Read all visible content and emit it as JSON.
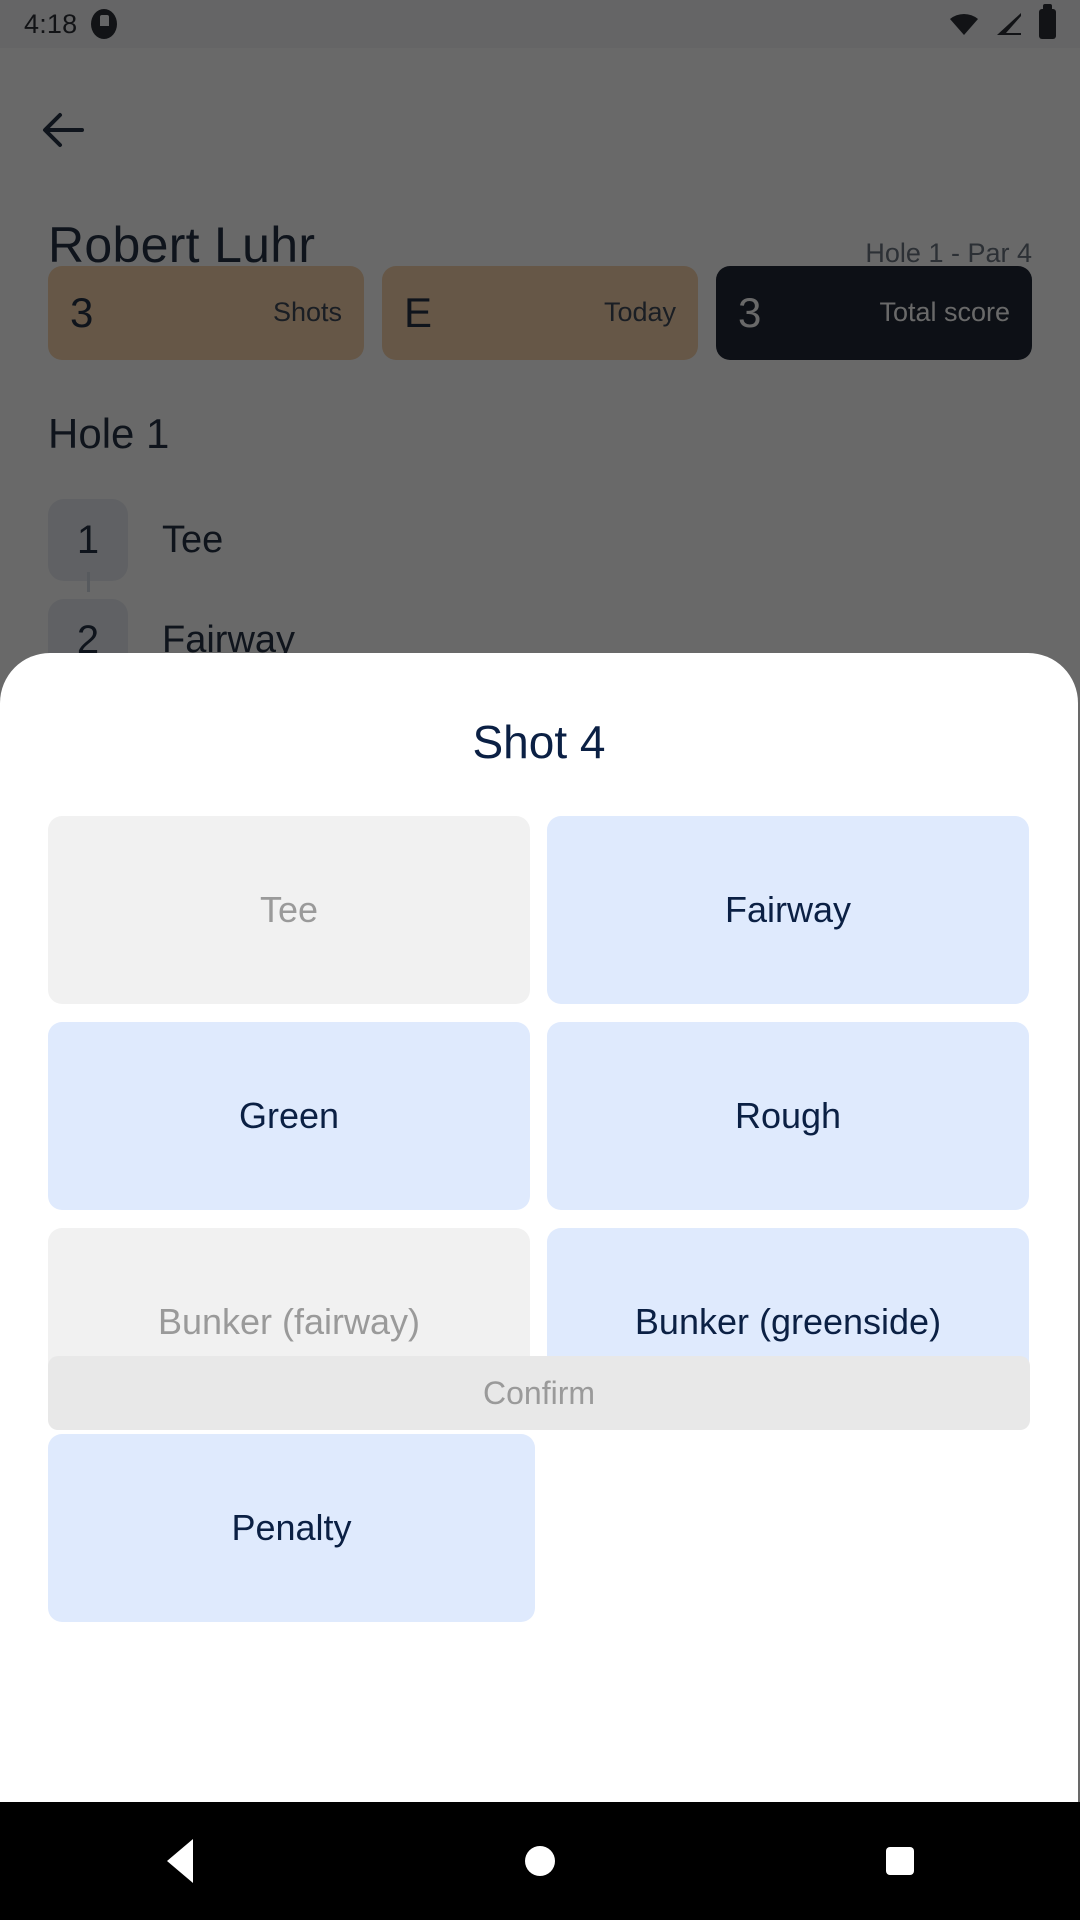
{
  "status_bar": {
    "time": "4:18",
    "icons": [
      "notification-icon",
      "wifi-icon",
      "cellular-signal-icon",
      "battery-icon"
    ]
  },
  "app_screen": {
    "back_icon": "arrow-left-icon",
    "player_name": "Robert Luhr",
    "hole_par": "Hole 1 - Par 4",
    "stats": [
      {
        "value": "3",
        "label": "Shots",
        "variant": "amber"
      },
      {
        "value": "E",
        "label": "Today",
        "variant": "amber"
      },
      {
        "value": "3",
        "label": "Total score",
        "variant": "dark"
      }
    ],
    "hole_heading": "Hole 1",
    "shots": [
      {
        "number": "1",
        "lie": "Tee"
      },
      {
        "number": "2",
        "lie": "Fairway"
      }
    ]
  },
  "sheet": {
    "title": "Shot 4",
    "options": [
      {
        "label": "Tee",
        "enabled": false
      },
      {
        "label": "Fairway",
        "enabled": true
      },
      {
        "label": "Green",
        "enabled": true
      },
      {
        "label": "Rough",
        "enabled": true
      },
      {
        "label": "Bunker (fairway)",
        "enabled": false
      },
      {
        "label": "Bunker (greenside)",
        "enabled": true
      },
      {
        "label": "Penalty",
        "enabled": true
      }
    ],
    "confirm_label": "Confirm",
    "confirm_enabled": false
  },
  "nav_bar": {
    "back": "back-triangle-icon",
    "home": "home-circle-icon",
    "recents": "recents-square-icon"
  },
  "colors": {
    "accent_blue": "#dfeafd",
    "text_navy": "#0b2044",
    "disabled_bg": "#f1f1f1",
    "disabled_text": "#9a9a9a",
    "dark_card": "#07101e",
    "amber_card": "#f6cfa2"
  }
}
